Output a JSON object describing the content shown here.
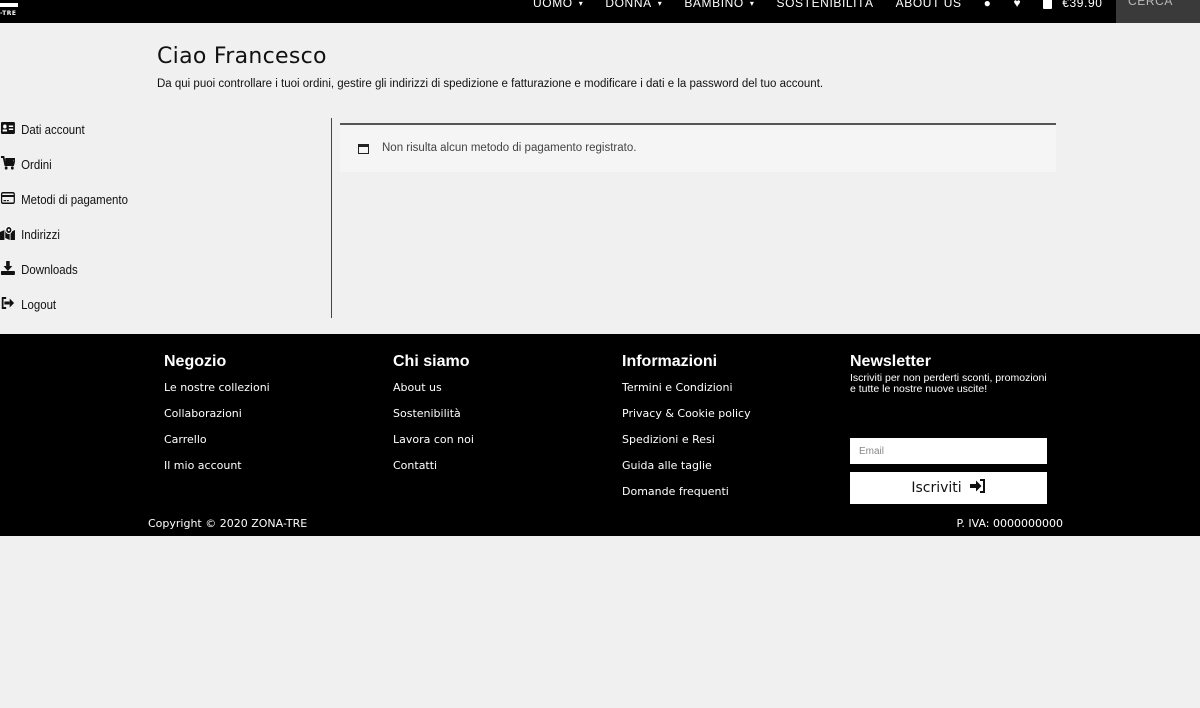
{
  "header": {
    "logo_text": "-TRE",
    "nav": [
      {
        "label": "UOMO"
      },
      {
        "label": "DONNA"
      },
      {
        "label": "BAMBINO"
      },
      {
        "label": "SOSTENIBILITÀ"
      },
      {
        "label": "ABOUT US"
      }
    ],
    "cart_total": "€39.90",
    "search_label": "CERCA",
    "icons": [
      "user-icon",
      "heart-icon",
      "bag-icon"
    ]
  },
  "page": {
    "title": "Ciao Francesco",
    "intro": "Da qui puoi controllare i tuoi ordini, gestire gli indirizzi di spedizione e fatturazione e modificare i dati e la password del tuo account."
  },
  "account_nav": {
    "items": [
      {
        "label": "Dati account",
        "icon": "id-card-icon"
      },
      {
        "label": "Ordini",
        "icon": "cart-icon"
      },
      {
        "label": "Metodi di pagamento",
        "icon": "credit-card-icon"
      },
      {
        "label": "Indirizzi",
        "icon": "map-icon"
      },
      {
        "label": "Downloads",
        "icon": "download-icon"
      },
      {
        "label": "Logout",
        "icon": "logout-icon"
      }
    ]
  },
  "notice": {
    "message": "Non risulta alcun metodo di pagamento registrato."
  },
  "footer": {
    "columns": [
      {
        "title": "Negozio",
        "links": [
          "Le nostre collezioni",
          "Collaborazioni",
          "Carrello",
          "Il mio account"
        ]
      },
      {
        "title": "Chi siamo",
        "links": [
          "About us",
          "Sostenibilità",
          "Lavora con noi",
          "Contatti"
        ]
      },
      {
        "title": "Informazioni",
        "links": [
          "Termini e Condizioni",
          "Privacy & Cookie policy",
          "Spedizioni e Resi",
          "Guida alle taglie",
          "Domande frequenti"
        ]
      }
    ],
    "newsletter": {
      "title": "Newsletter",
      "description": "Iscriviti per non perderti sconti, promozioni e tutte le nostre nuove uscite!",
      "email_placeholder": "Email",
      "button_label": "Iscriviti"
    },
    "copyright": "Copyright © 2020 ZONA-TRE",
    "vat": "P. IVA: 0000000000"
  },
  "colors": {
    "topbar": "#000000",
    "background": "#f0f0f0",
    "footer": "#000000",
    "search_bg": "#3a3a3a"
  }
}
